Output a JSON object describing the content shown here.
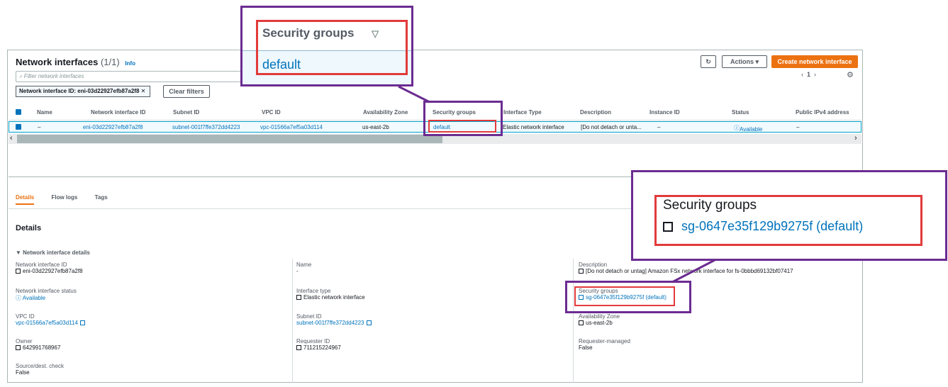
{
  "header": {
    "title": "Network interfaces",
    "count": "(1/1)",
    "info": "Info",
    "search_placeholder": "Filter network interfaces",
    "filter_token": "Network interface ID: eni-03d22927efb87a2f8",
    "clear_filters": "Clear filters",
    "actions": "Actions",
    "create": "Create network interface",
    "page": "1"
  },
  "columns": [
    "Name",
    "Network interface ID",
    "Subnet ID",
    "VPC ID",
    "Availability Zone",
    "Security groups",
    "Interface Type",
    "Description",
    "Instance ID",
    "Status",
    "Public IPv4 address"
  ],
  "row": {
    "name": "–",
    "eni": "eni-03d22927efb87a2f8",
    "subnet": "subnet-001f7ffe372dd4223",
    "vpc": "vpc-01566a7ef5a03d114",
    "az": "us-east-2b",
    "sg": "default",
    "type": "Elastic network interface",
    "description": "[Do not detach or unta...",
    "instance": "–",
    "status": "Available",
    "public_ip": "–"
  },
  "tabs": [
    "Details",
    "Flow logs",
    "Tags"
  ],
  "details": {
    "heading": "Details",
    "section": "Network interface details",
    "eni_label": "Network interface ID",
    "eni_value": "eni-03d22927efb87a2f8",
    "status_label": "Network interface status",
    "status_value": "Available",
    "vpc_label": "VPC ID",
    "vpc_value": "vpc-01566a7ef5a03d114",
    "owner_label": "Owner",
    "owner_value": "642991768967",
    "srcdest_label": "Source/dest. check",
    "srcdest_value": "False",
    "name_label": "Name",
    "name_value": "-",
    "type_label": "Interface type",
    "type_value": "Elastic network interface",
    "subnet_label": "Subnet ID",
    "subnet_value": "subnet-001f7ffe372dd4223",
    "requester_label": "Requester ID",
    "requester_value": "711215224967",
    "desc_label": "Description",
    "desc_value": "[Do not detach or untag] Amazon FSx network interface for fs-0bbbd69132bf07417",
    "sg_label": "Security groups",
    "sg_value": "sg-0647e35f129b9275f (default)",
    "az_label": "Availability Zone",
    "az_value": "us-east-2b",
    "rm_label": "Requester-managed",
    "rm_value": "False"
  },
  "callout_top": {
    "label": "Security groups",
    "value": "default"
  },
  "callout_right": {
    "label": "Security groups",
    "value": "sg-0647e35f129b9275f (default)"
  },
  "colors": {
    "accent": "#ec7211",
    "link": "#0073bb",
    "callout": "#6b2c91",
    "highlight": "#e23b3b"
  }
}
